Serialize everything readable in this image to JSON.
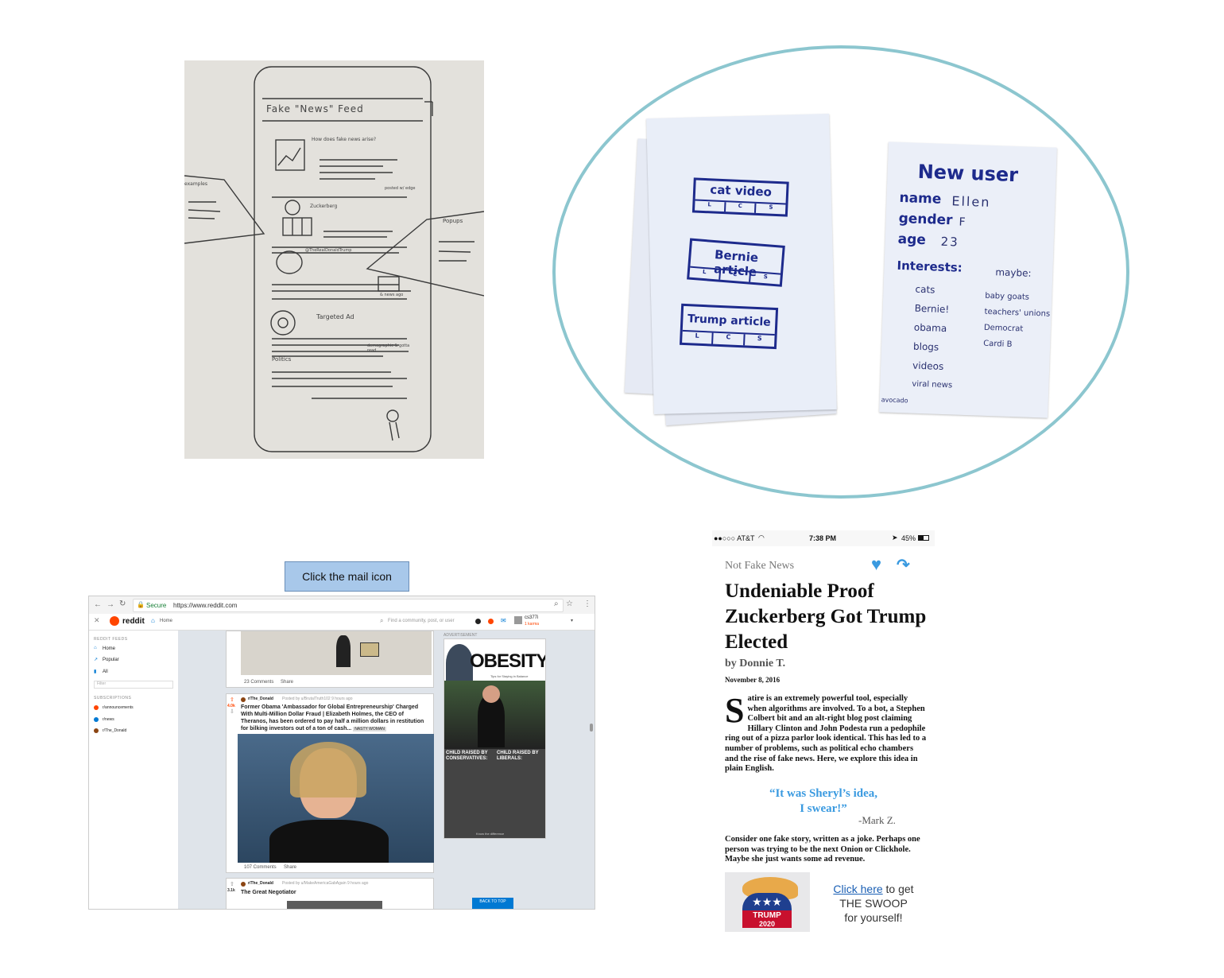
{
  "sketch": {
    "title": "Fake \"News\" Feed",
    "question": "How does fake news arise?",
    "left_note": "examples",
    "right_note": "Popups",
    "item1": "Zuckerberg",
    "item2": "@TheRealDonaldTrump",
    "item3": "Targeted Ad",
    "item4": "Politics",
    "small_note1": "posted w/ edge",
    "small_note2": "& news ago",
    "small_note3": "demographic & gotta read"
  },
  "cards": {
    "card1": {
      "label": "cat video",
      "buttons": [
        "L",
        "C",
        "S"
      ]
    },
    "card2": {
      "label": "Bernie article",
      "buttons": [
        "L",
        "C",
        "S"
      ]
    },
    "card3": {
      "label": "Trump article",
      "buttons": [
        "L",
        "C",
        "S"
      ]
    },
    "user": {
      "title": "New user",
      "name_label": "name",
      "name_value": "Ellen",
      "gender_label": "gender",
      "gender_value": "F",
      "age_label": "age",
      "age_value": "23",
      "interests_label": "Interests:",
      "interests": [
        "cats",
        "Bernie!",
        "obama",
        "blogs",
        "videos",
        "viral news"
      ],
      "maybe_label": "maybe:",
      "maybe": [
        "baby goats",
        "teachers' unions",
        "Democrat",
        "Cardi B"
      ],
      "footer": "avocado"
    }
  },
  "reddit": {
    "instruction_button": "Click the mail icon",
    "url_secure": "Secure",
    "url": "https://www.reddit.com",
    "logo": "reddit",
    "home_tab": "Home",
    "search_placeholder": "Find a community, post, or user",
    "username": "cs377i",
    "karma": "1 karma",
    "feeds_header": "REDDIT FEEDS",
    "feeds": [
      "Home",
      "Popular",
      "All"
    ],
    "filter_placeholder": "Filter",
    "subs_header": "SUBSCRIPTIONS",
    "subs": [
      "r/announcements",
      "r/news",
      "r/The_Donald"
    ],
    "post0_comments": "23 Comments",
    "post0_share": "Share",
    "post1": {
      "votes": "4.0k",
      "subreddit": "r/The_Donald",
      "meta": "Posted by u/BrutalTruth102 9 hours ago",
      "title": "Former Obama 'Ambassador for Global Entrepreneurship' Charged With Multi-Million Dollar Fraud | Elizabeth Holmes, the CEO of Theranos, has been ordered to pay half a million dollars in restitution for bilking investors out of a ton of cash...",
      "flair": "NASTY WOMAN",
      "comments": "107 Comments",
      "share": "Share"
    },
    "post2": {
      "votes": "3.1k",
      "subreddit": "r/The_Donald",
      "meta": "Posted by u/MakeAmericaGabAgain 9 hours ago",
      "title": "The Great Negotiator"
    },
    "ad_label": "ADVERTISEMENT",
    "ad_title": "OBESITY",
    "ad_sub": "Tips for Staying in Balance",
    "ad_left": "CHILD RAISED BY CONSERVATIVES:",
    "ad_right": "CHILD RAISED BY LIBERALS:",
    "ad_foot": "Know the difference",
    "back_to_top": "BACK TO TOP"
  },
  "article": {
    "status_carrier": "●●○○○ AT&T",
    "status_time": "7:38 PM",
    "status_battery": "45%",
    "site": "Not Fake News",
    "headline": "Undeniable Proof Zuckerberg Got Trump Elected",
    "byline": "by Donnie T.",
    "date": "November 8, 2016",
    "dropcap": "S",
    "para1": "atire is an extremely powerful tool, especially when algorithms are involved. To a bot, a Stephen Colbert bit and an alt-right blog post claiming Hillary Clinton and John Podesta run a pedophile ring out of a pizza parlor look identical. This has led to a number of problems, such as political echo chambers and the rise of fake news. Here, we explore this idea in plain English.",
    "quote_line1": "“It was Sheryl’s idea,",
    "quote_line2": "I swear!”",
    "quote_author": "-Mark Z.",
    "para2": "Consider one fake story, written as a joke. Perhaps one person was trying to be the next Onion or Clickhole. Maybe she just wants some ad revenue.",
    "ad_link": "Click here",
    "ad_text1": " to get",
    "ad_text2": "THE SWOOP",
    "ad_text3": "for yourself!",
    "ad_badge": "TRUMP",
    "ad_year": "2020"
  },
  "colors": {
    "circle": "#8cc6cf",
    "marker": "#1d2a8c",
    "link": "#1a5fb4",
    "quote": "#3a9ae0",
    "reddit_orange": "#ff4500"
  }
}
